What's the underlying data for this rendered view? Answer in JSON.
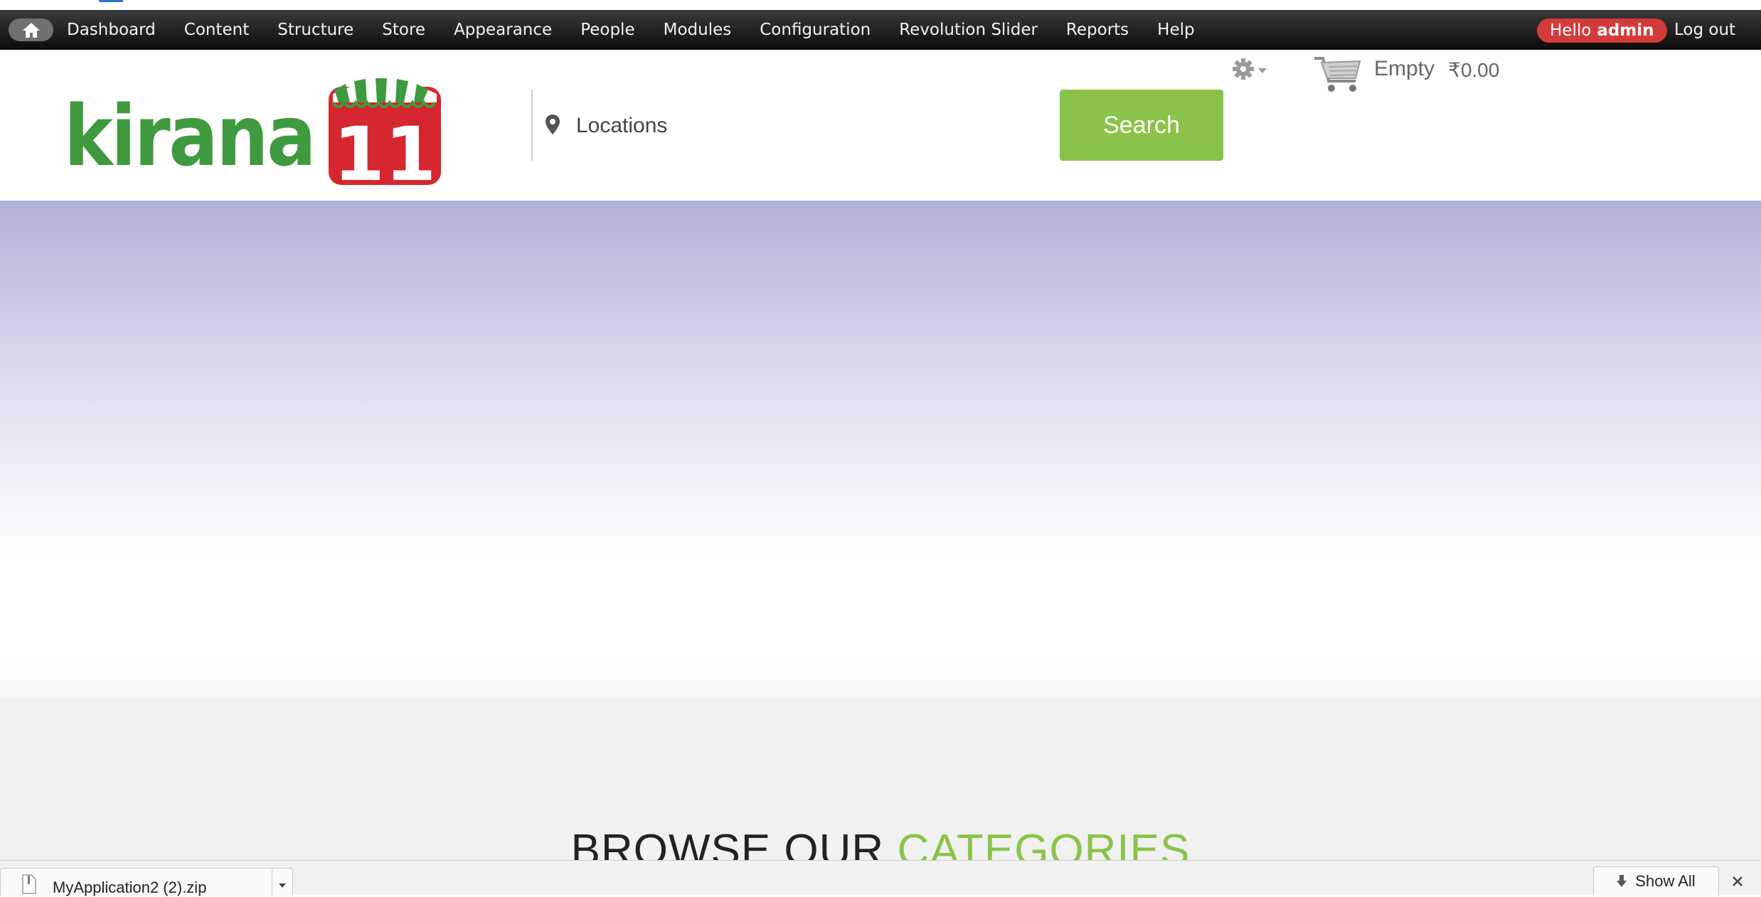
{
  "toolbar": {
    "menu": [
      "Dashboard",
      "Content",
      "Structure",
      "Store",
      "Appearance",
      "People",
      "Modules",
      "Configuration",
      "Revolution Slider",
      "Reports",
      "Help"
    ],
    "hello_prefix": "Hello",
    "hello_user": "admin",
    "logout": "Log out"
  },
  "header": {
    "logo_text": "kirana",
    "logo_number": "11",
    "location_placeholder": "Locations",
    "search_label": "Search",
    "cart_status": "Empty",
    "cart_total": "₹0.00"
  },
  "content": {
    "heading_part1": "BROWSE OUR",
    "heading_part2": "CATEGORIES"
  },
  "downloads": {
    "file_name": "MyApplication2 (2).zip",
    "show_all": "Show All"
  },
  "colors": {
    "accent_green": "#8bc34a",
    "hello_red": "#d33a3a",
    "logo_green": "#3f9a3f",
    "logo_red": "#d6262f"
  }
}
